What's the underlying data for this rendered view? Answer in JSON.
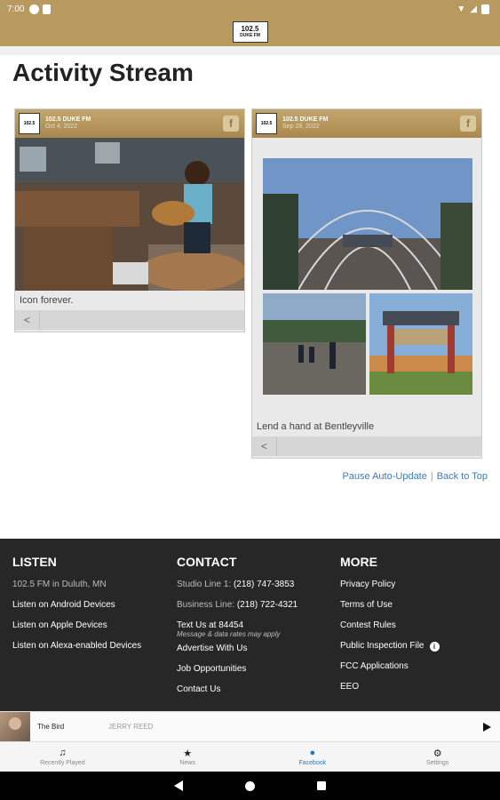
{
  "status_bar": {
    "time": "7:00"
  },
  "app_bar": {
    "logo_text": "102.5",
    "logo_sub": "DUKE FM"
  },
  "page": {
    "title": "Activity Stream"
  },
  "posts": [
    {
      "author": "102.5 DUKE FM",
      "date": "Oct 4, 2022",
      "caption": "Icon forever."
    },
    {
      "author": "102.5 DUKE FM",
      "date": "Sep 28, 2022",
      "caption": "Lend a hand at Bentleyville"
    }
  ],
  "post_icons": {
    "facebook": "f",
    "share": "<"
  },
  "links": {
    "pause": "Pause Auto-Update",
    "separator": "|",
    "back_to_top": "Back to Top"
  },
  "footer": {
    "listen": {
      "heading": "LISTEN",
      "items": [
        "102.5 FM in Duluth, MN",
        "Listen on Android Devices",
        "Listen on Apple Devices",
        "Listen on Alexa-enabled Devices"
      ]
    },
    "contact": {
      "heading": "CONTACT",
      "studio_label": "Studio Line 1:",
      "studio_number": "(218) 747-3853",
      "business_label": "Business Line:",
      "business_number": "(218) 722-4321",
      "text_us": "Text Us at 84454",
      "text_note": "Message & data rates may apply",
      "items": [
        "Advertise With Us",
        "Job Opportunities",
        "Contact Us"
      ]
    },
    "more": {
      "heading": "MORE",
      "items": [
        "Privacy Policy",
        "Terms of Use",
        "Contest Rules",
        "Public Inspection File",
        "FCC Applications",
        "EEO"
      ]
    }
  },
  "player": {
    "song": "The Bird",
    "artist": "JERRY REED"
  },
  "tabs": [
    {
      "label": "Recently Played",
      "icon": "music-note-icon"
    },
    {
      "label": "News",
      "icon": "star-icon"
    },
    {
      "label": "Facebook",
      "icon": "facebook-icon",
      "active": true
    },
    {
      "label": "Settings",
      "icon": "gear-icon"
    }
  ],
  "colors": {
    "brand_gold": "#b8995f",
    "footer_bg": "#272727",
    "link_blue": "#3c7ab8"
  }
}
